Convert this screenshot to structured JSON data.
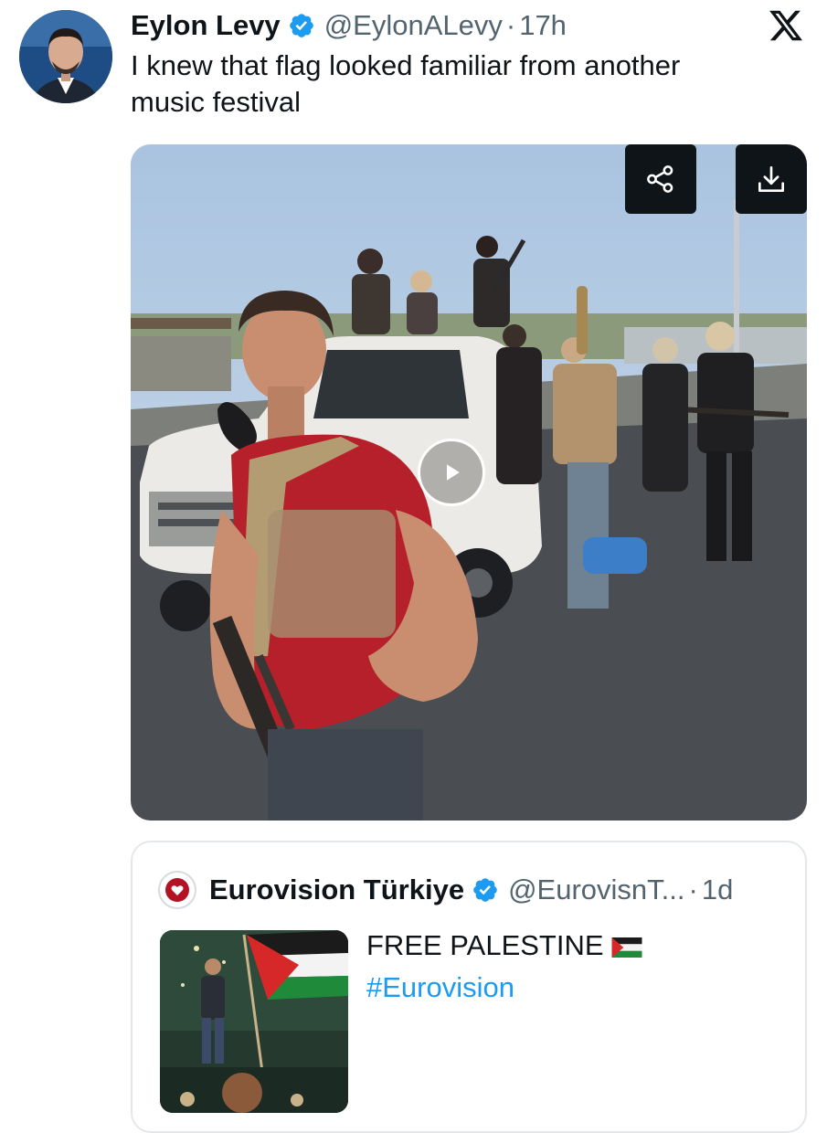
{
  "tweet": {
    "author_name": "Eylon Levy",
    "handle": "@EylonALevy",
    "separator": "·",
    "time": "17h",
    "text_line1": "I knew that flag looked familiar from another",
    "text_line2": "music festival",
    "verified_color": "#1d9bf0"
  },
  "media": {
    "share_icon": "share-icon",
    "download_icon": "download-icon",
    "play_icon": "play-icon"
  },
  "quoted": {
    "author_name": "Eurovision Türkiye",
    "handle": "@EurovisnT...",
    "separator": "·",
    "time": "1d",
    "text_line1": "FREE PALESTINE",
    "hashtag": "#Eurovision",
    "flag_emoji": "palestine-flag",
    "link_color": "#1d9bf0"
  },
  "logo": "x-logo"
}
